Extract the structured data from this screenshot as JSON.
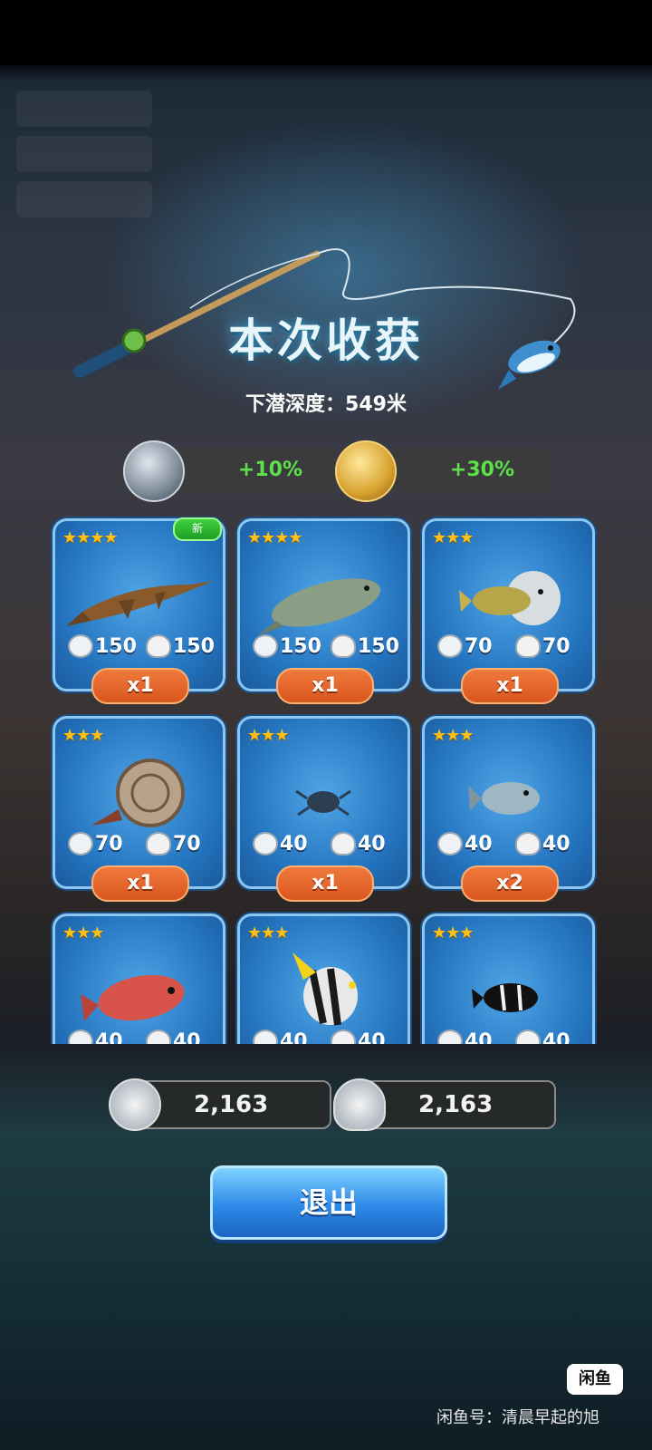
{
  "header": {
    "title": "本次收获",
    "depth_label": "下潜深度：549米"
  },
  "bonuses": [
    {
      "icon": "diving-helmet-icon",
      "value": "+10%"
    },
    {
      "icon": "gold-medal-icon",
      "value": "+30%"
    }
  ],
  "catches": [
    {
      "stars": "★★★★",
      "fish": "sawfish",
      "coin": "150",
      "shell": "150",
      "qty": "x1",
      "is_new": true,
      "new_label": "新"
    },
    {
      "stars": "★★★★",
      "fish": "trout",
      "coin": "150",
      "shell": "150",
      "qty": "x1",
      "is_new": false
    },
    {
      "stars": "★★★",
      "fish": "pufferfish",
      "coin": "70",
      "shell": "70",
      "qty": "x1",
      "is_new": false
    },
    {
      "stars": "★★★",
      "fish": "nautilus",
      "coin": "70",
      "shell": "70",
      "qty": "x1",
      "is_new": false
    },
    {
      "stars": "★★★",
      "fish": "crab",
      "coin": "40",
      "shell": "40",
      "qty": "x1",
      "is_new": false
    },
    {
      "stars": "★★★",
      "fish": "spotted-fish",
      "coin": "40",
      "shell": "40",
      "qty": "x2",
      "is_new": false
    },
    {
      "stars": "★★★",
      "fish": "red-snapper",
      "coin": "40",
      "shell": "40",
      "qty": "",
      "is_new": false
    },
    {
      "stars": "★★★",
      "fish": "angelfish",
      "coin": "40",
      "shell": "40",
      "qty": "",
      "is_new": false
    },
    {
      "stars": "★★★",
      "fish": "black-clownfish",
      "coin": "40",
      "shell": "40",
      "qty": "",
      "is_new": false
    }
  ],
  "totals": {
    "coins": "2,163",
    "shells": "2,163"
  },
  "exit_label": "退出",
  "watermark": {
    "logo": "闲鱼",
    "text": "闲鱼号：清晨早起的旭"
  },
  "colors": {
    "card": "#2f86d2",
    "qty_badge": "#e2612a",
    "bonus_text": "#5ee04a",
    "exit_button": "#2d8ae8",
    "stars": "#ffc21a"
  }
}
